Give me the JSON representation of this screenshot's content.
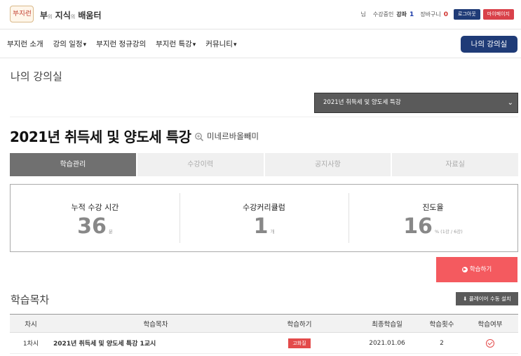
{
  "header": {
    "logo_badge": "부·지·런",
    "logo_parts": [
      "부",
      "의",
      " 지식",
      "의",
      " 배움터"
    ],
    "user_suffix": "님",
    "enrolled_label": "수강중인",
    "enrolled_word": "강좌",
    "enrolled_count": "1",
    "cart_label": "장바구니",
    "cart_count": "0",
    "logout_label": "로그아웃",
    "mypage_label": "마이페이지"
  },
  "nav": {
    "items": [
      "부지런 소개",
      "강의 일정",
      "부지런 정규강의",
      "부지런 특강",
      "커뮤니티"
    ],
    "my_class_label": "나의 강의실"
  },
  "page": {
    "title": "나의 강의실",
    "selected_course": "2021년 취득세 및 양도세 특강",
    "course_title": "2021년 취득세 및 양도세 특강",
    "teacher": "미네르바올빼미"
  },
  "tabs": [
    "학습관리",
    "수강이력",
    "공지사항",
    "자료실"
  ],
  "stats": [
    {
      "label": "누적 수강 시간",
      "value": "36",
      "unit": "분"
    },
    {
      "label": "수강커리큘럼",
      "value": "1",
      "unit": "개"
    },
    {
      "label": "진도율",
      "value": "16",
      "unit": "% (1강 / 6강)"
    }
  ],
  "study_button": "학습하기",
  "section": {
    "title": "학습목차",
    "install_button": "플레이어 수동 설치"
  },
  "table": {
    "headers": [
      "차시",
      "학습목차",
      "학습하기",
      "최종학습일",
      "학습횟수",
      "학습여부"
    ],
    "rows": [
      {
        "no": "1차시",
        "title": "2021년 취득세 및 양도세 특강 1교시",
        "study": "고화질",
        "last": "2021.01.06",
        "count": "2"
      }
    ]
  },
  "colors": {
    "navy": "#1f3b77",
    "accent_red": "#f45a5f",
    "tag_red": "#e34a4a"
  }
}
